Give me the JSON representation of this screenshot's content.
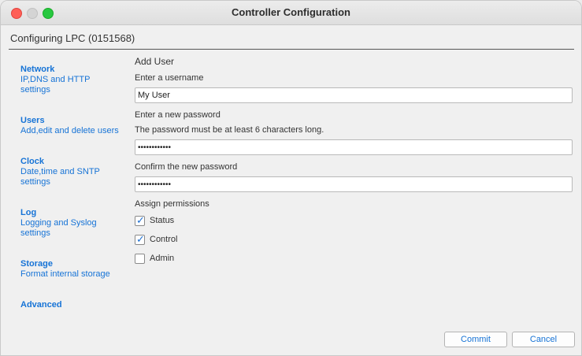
{
  "window": {
    "title": "Controller Configuration"
  },
  "header": {
    "label": "Configuring LPC (0151568)"
  },
  "sidebar": {
    "items": [
      {
        "title": "Network",
        "desc": [
          "IP,DNS and HTTP",
          "settings"
        ]
      },
      {
        "title": "Users",
        "desc": [
          "Add,edit and delete users"
        ]
      },
      {
        "title": "Clock",
        "desc": [
          "Date,time and SNTP",
          "settings"
        ]
      },
      {
        "title": "Log",
        "desc": [
          "Logging and Syslog",
          "settings"
        ]
      },
      {
        "title": "Storage",
        "desc": [
          "Format internal storage"
        ]
      },
      {
        "title": "Advanced",
        "desc": []
      }
    ]
  },
  "form": {
    "heading": "Add User",
    "username_label": "Enter a username",
    "username_value": "My User",
    "password_label": "Enter a new password",
    "password_hint": "The password must be at least 6 characters long.",
    "password_value": "••••••••••••",
    "confirm_label": "Confirm the new password",
    "confirm_value": "••••••••••••",
    "permissions_label": "Assign permissions",
    "permissions": [
      {
        "label": "Status",
        "checked": true
      },
      {
        "label": "Control",
        "checked": true
      },
      {
        "label": "Admin",
        "checked": false
      }
    ]
  },
  "buttons": {
    "commit": "Commit",
    "cancel": "Cancel"
  },
  "colors": {
    "accent": "#1673d6",
    "close": "#fe5f57",
    "maximize": "#28c840"
  }
}
